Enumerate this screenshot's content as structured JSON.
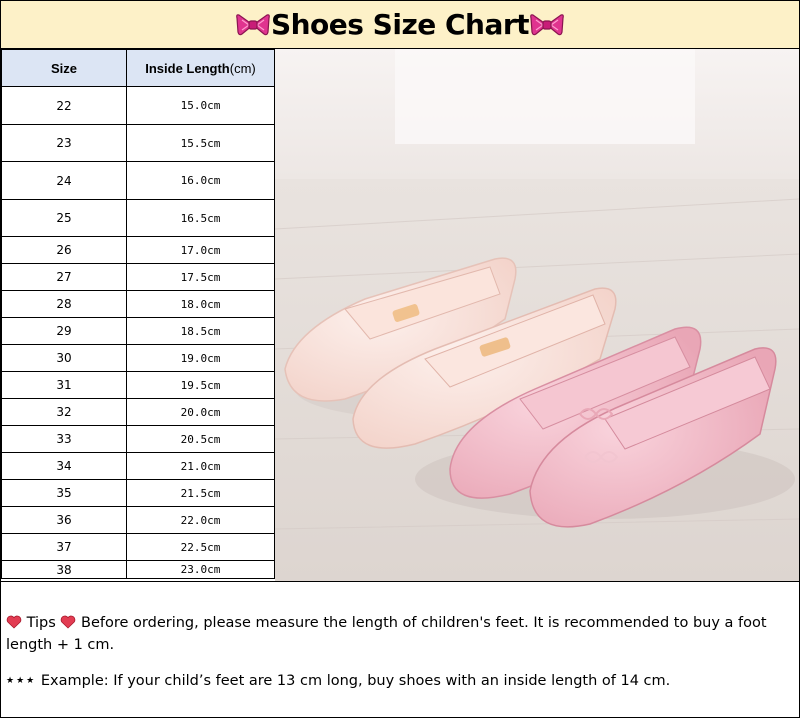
{
  "header": {
    "title": "Shoes Size Chart",
    "bow_color": "#e0348f",
    "background": "#fdf1c8"
  },
  "table": {
    "header_size": "Size",
    "header_length": "Inside Length",
    "header_unit": "(cm)",
    "header_background": "#dce5f4",
    "rows": [
      {
        "size": "22",
        "length": "15.0cm"
      },
      {
        "size": "23",
        "length": "15.5cm"
      },
      {
        "size": "24",
        "length": "16.0cm"
      },
      {
        "size": "25",
        "length": "16.5cm"
      },
      {
        "size": "26",
        "length": "17.0cm"
      },
      {
        "size": "27",
        "length": "17.5cm"
      },
      {
        "size": "28",
        "length": "18.0cm"
      },
      {
        "size": "29",
        "length": "18.5cm"
      },
      {
        "size": "30",
        "length": "19.0cm"
      },
      {
        "size": "31",
        "length": "19.5cm"
      },
      {
        "size": "32",
        "length": "20.0cm"
      },
      {
        "size": "33",
        "length": "20.5cm"
      },
      {
        "size": "34",
        "length": "21.0cm"
      },
      {
        "size": "35",
        "length": "21.5cm"
      },
      {
        "size": "36",
        "length": "22.0cm"
      },
      {
        "size": "37",
        "length": "22.5cm"
      },
      {
        "size": "38",
        "length": "23.0cm"
      }
    ]
  },
  "photo": {
    "subject": "ballet-shoes",
    "shoe_colors": [
      "#f7dcd4",
      "#f1b8c4"
    ]
  },
  "notes": {
    "tips_label": "Tips",
    "tips_text": "Before ordering, please measure the length of children's feet. It is recommended to buy a foot length + 1 cm.",
    "example_stars": "★★★",
    "example_text": "Example: If your child’s feet are 13 cm long, buy shoes with an inside length of 14 cm.",
    "heart_color": "#e23c52"
  }
}
